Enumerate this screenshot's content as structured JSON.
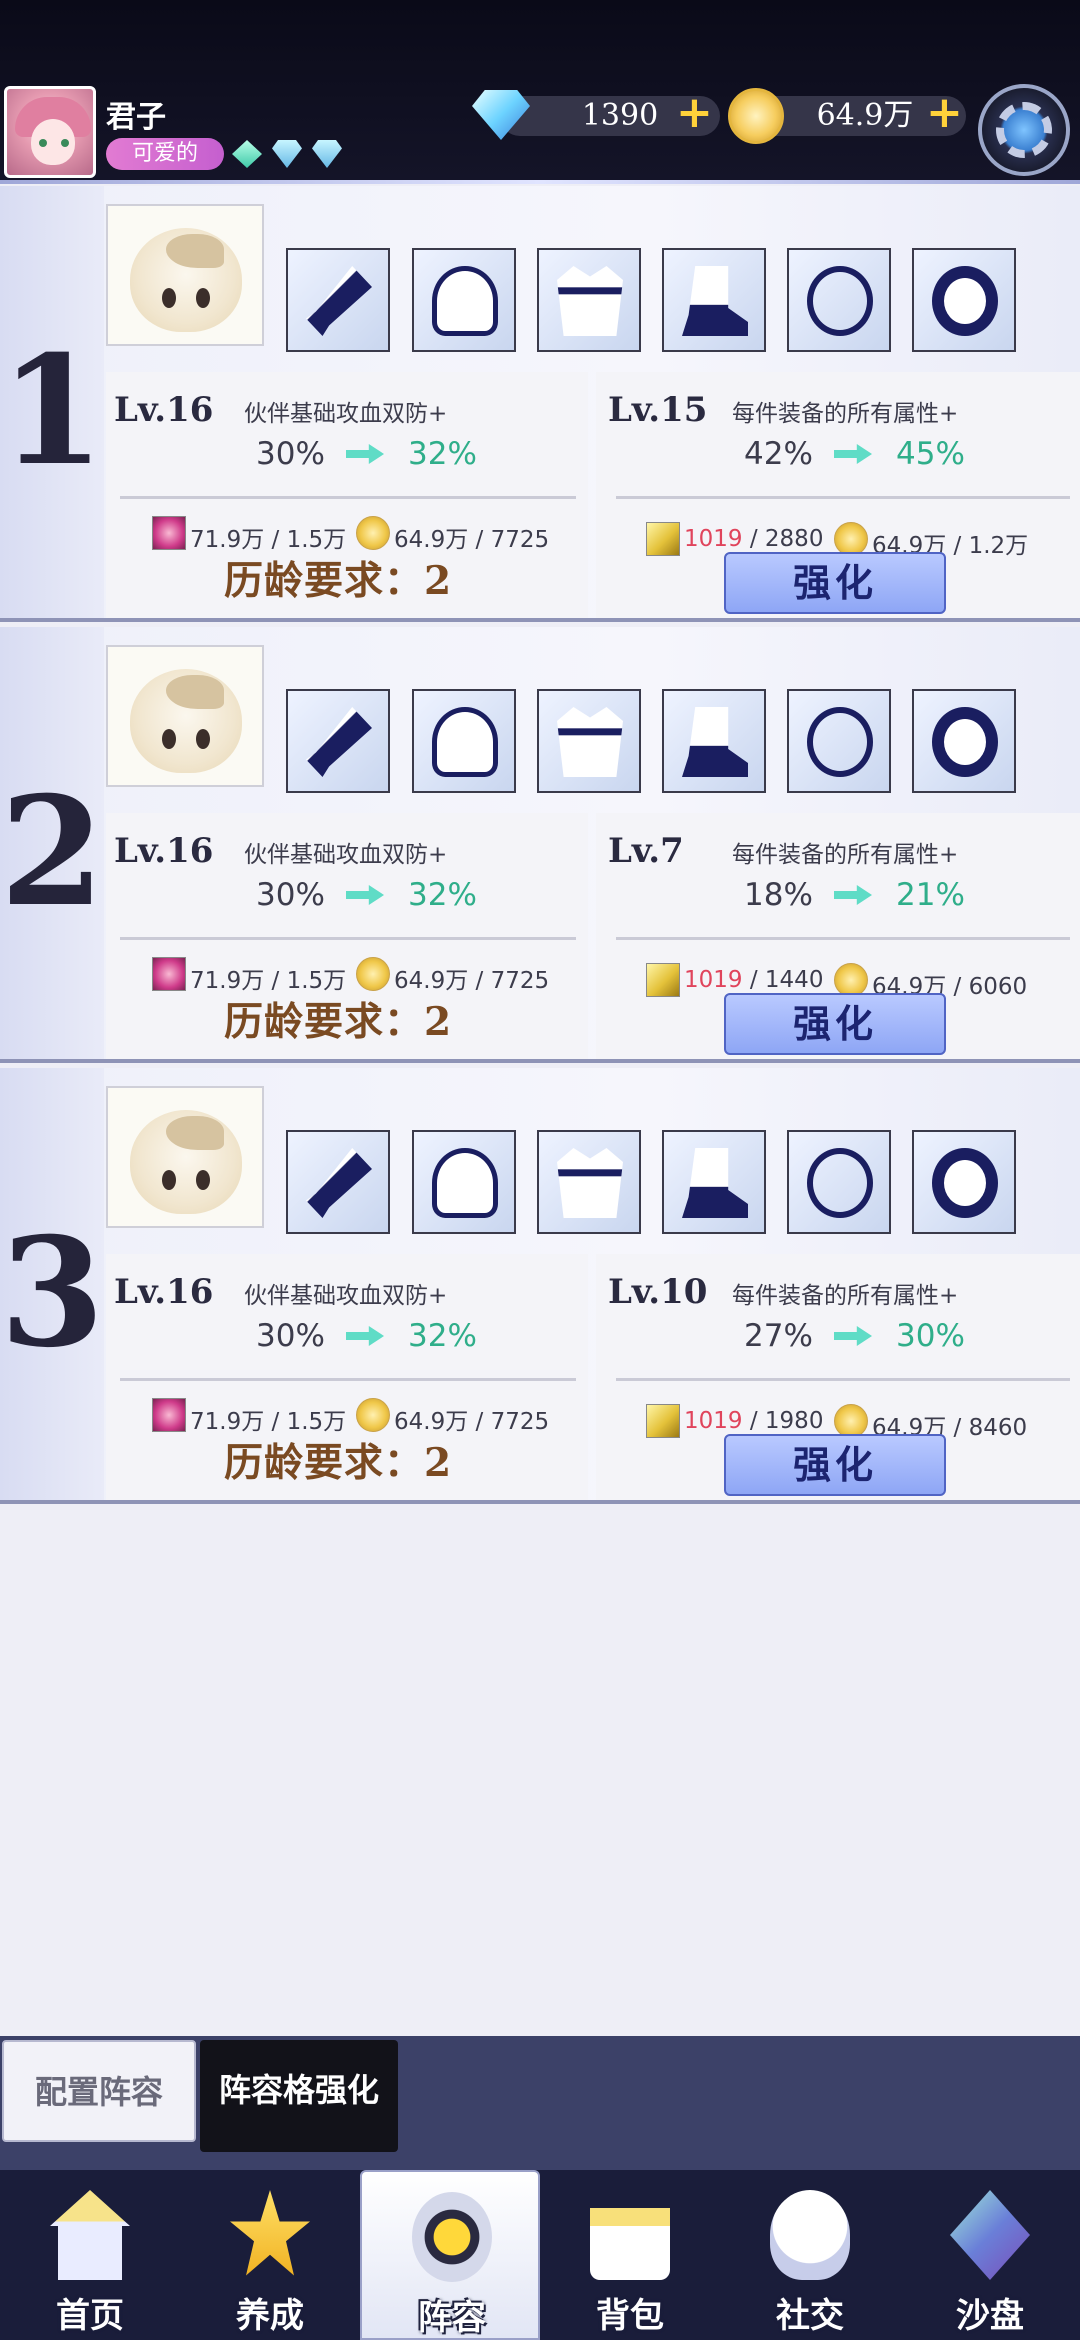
{
  "header": {
    "username": "君子",
    "title_badge": "可爱的",
    "diamonds": "1390",
    "coins": "64.9万"
  },
  "rows": [
    {
      "num": "1",
      "partner": {
        "level": "Lv.16",
        "desc": "伙伴基础攻血双防+",
        "old_pct": "30%",
        "new_pct": "32%",
        "cost1": "71.9万 / 1.5万",
        "cost2": "64.9万 / 7725",
        "requirement": "历龄要求：",
        "req_value": "2"
      },
      "equip": {
        "level": "Lv.15",
        "desc": "每件装备的所有属性+",
        "old_pct": "42%",
        "new_pct": "45%",
        "stone_have": "1019",
        "stone_need": " / 2880",
        "cost2": "64.9万 / 1.2万",
        "button": "强化"
      }
    },
    {
      "num": "2",
      "partner": {
        "level": "Lv.16",
        "desc": "伙伴基础攻血双防+",
        "old_pct": "30%",
        "new_pct": "32%",
        "cost1": "71.9万 / 1.5万",
        "cost2": "64.9万 / 7725",
        "requirement": "历龄要求：",
        "req_value": "2"
      },
      "equip": {
        "level": "Lv.7",
        "desc": "每件装备的所有属性+",
        "old_pct": "18%",
        "new_pct": "21%",
        "stone_have": "1019",
        "stone_need": " / 1440",
        "cost2": "64.9万 / 6060",
        "button": "强化"
      }
    },
    {
      "num": "3",
      "partner": {
        "level": "Lv.16",
        "desc": "伙伴基础攻血双防+",
        "old_pct": "30%",
        "new_pct": "32%",
        "cost1": "71.9万 / 1.5万",
        "cost2": "64.9万 / 7725",
        "requirement": "历龄要求：",
        "req_value": "2"
      },
      "equip": {
        "level": "Lv.10",
        "desc": "每件装备的所有属性+",
        "old_pct": "27%",
        "new_pct": "30%",
        "stone_have": "1019",
        "stone_need": " / 1980",
        "cost2": "64.9万 / 8460",
        "button": "强化"
      }
    }
  ],
  "sub_tabs": {
    "configure": "配置阵容",
    "enhance": "阵容格强化"
  },
  "nav": {
    "home": "首页",
    "develop": "养成",
    "formation": "阵容",
    "bag": "背包",
    "social": "社交",
    "sandbox": "沙盘"
  },
  "colors": {
    "accent_green": "#2fae8a",
    "cost_red": "#e0445c",
    "button_blue": "#8ea6f5",
    "requirement_brown": "#7a4a22"
  }
}
